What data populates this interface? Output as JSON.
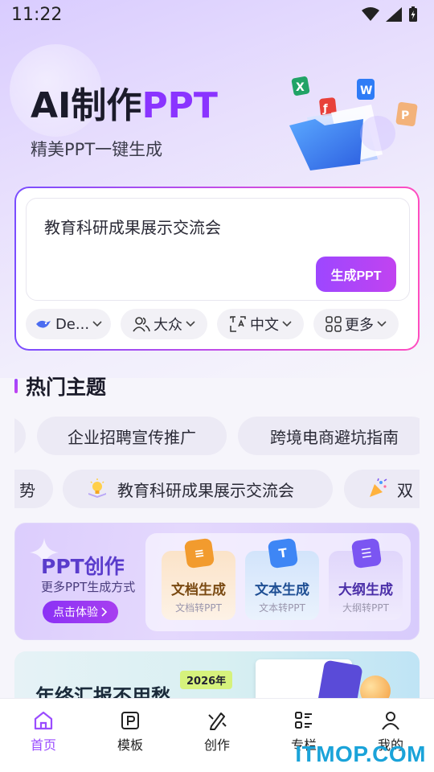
{
  "status_bar": {
    "time": "11:22"
  },
  "hero": {
    "title_prefix": "AI制作",
    "title_accent": "PPT",
    "subtitle": "精美PPT一键生成"
  },
  "input_card": {
    "text": "教育科研成果展示交流会",
    "generate_label": "生成PPT",
    "options": [
      {
        "label": "De...",
        "icon": "model-icon"
      },
      {
        "label": "大众",
        "icon": "audience-icon"
      },
      {
        "label": "中文",
        "icon": "translate-icon"
      },
      {
        "label": "更多",
        "icon": "grid-icon"
      }
    ]
  },
  "hot_topics": {
    "title": "热门主题",
    "row1": [
      "企业招聘宣传推广",
      "跨境电商避坑指南"
    ],
    "row2": [
      "势",
      "教育科研成果展示交流会",
      "双"
    ]
  },
  "ppt_create_banner": {
    "title": "PPT创作",
    "subtitle": "更多PPT生成方式",
    "cta": "点击体验",
    "features": [
      {
        "title": "文档生成",
        "desc": "文档转PPT",
        "color": "#f29b2e"
      },
      {
        "title": "文本生成",
        "desc": "文本转PPT",
        "color": "#3e86f5"
      },
      {
        "title": "大纲生成",
        "desc": "大纲转PPT",
        "color": "#7b55f2"
      }
    ]
  },
  "promo_banner": {
    "text": "年终汇报不用愁，",
    "tag": "2026年"
  },
  "tabbar": {
    "items": [
      {
        "label": "首页",
        "icon": "home-icon",
        "active": true
      },
      {
        "label": "模板",
        "icon": "template-icon",
        "active": false
      },
      {
        "label": "创作",
        "icon": "create-icon",
        "active": false
      },
      {
        "label": "专栏",
        "icon": "column-icon",
        "active": false
      },
      {
        "label": "我的",
        "icon": "profile-icon",
        "active": false
      }
    ]
  },
  "watermark": "ITMOP.COM",
  "colors": {
    "accent": "#9a4cff",
    "brand_gradient_end": "#c143f0"
  }
}
